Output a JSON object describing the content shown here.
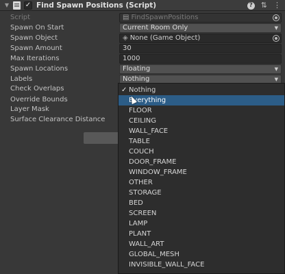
{
  "header": {
    "title": "Find Spawn Positions (Script)",
    "enabled": "✓",
    "help_icon": "?",
    "preset_icon": "⇅",
    "menu_icon": "⋮"
  },
  "properties": {
    "script": {
      "label": "Script",
      "value": "FindSpawnPositions"
    },
    "spawn_on_start": {
      "label": "Spawn On Start",
      "value": "Current Room Only"
    },
    "spawn_object": {
      "label": "Spawn Object",
      "value": "None (Game Object)"
    },
    "spawn_amount": {
      "label": "Spawn Amount",
      "value": "30"
    },
    "max_iterations": {
      "label": "Max Iterations",
      "value": "1000"
    },
    "spawn_locations": {
      "label": "Spawn Locations",
      "value": "Floating"
    },
    "labels": {
      "label": "Labels",
      "value": "Nothing"
    },
    "check_overlaps": {
      "label": "Check Overlaps"
    },
    "override_bounds": {
      "label": "Override Bounds"
    },
    "layer_mask": {
      "label": "Layer Mask"
    },
    "surface_clearance_distance": {
      "label": "Surface Clearance Distance"
    }
  },
  "dropdown": {
    "selected_check": "✓",
    "items": [
      "Nothing",
      "Everything",
      "FLOOR",
      "CEILING",
      "WALL_FACE",
      "TABLE",
      "COUCH",
      "DOOR_FRAME",
      "WINDOW_FRAME",
      "OTHER",
      "STORAGE",
      "BED",
      "SCREEN",
      "LAMP",
      "PLANT",
      "WALL_ART",
      "GLOBAL_MESH",
      "INVISIBLE_WALL_FACE"
    ],
    "checked_item": "Nothing",
    "highlighted_item": "Everything"
  },
  "icons": {
    "foldout": "chevron-down-icon",
    "script": "csharp-script-icon",
    "object_field": "gameobject-icon",
    "popup_arrow": "triangle-down-icon"
  }
}
